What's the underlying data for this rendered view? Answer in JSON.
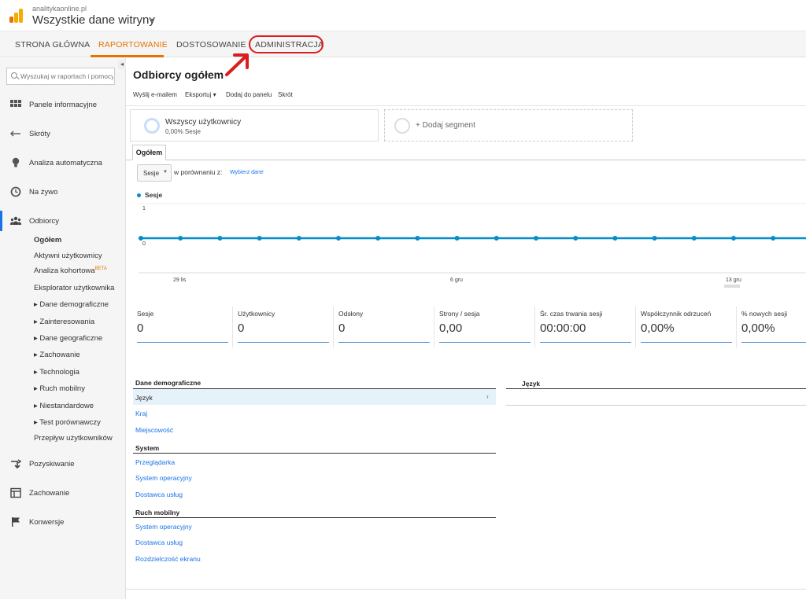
{
  "header": {
    "account": "analitykaonline.pl",
    "property": "Wszystkie dane witryny"
  },
  "nav": {
    "home": "STRONA GŁÓWNA",
    "reporting": "RAPORTOWANIE",
    "customization": "DOSTOSOWANIE",
    "admin": "ADMINISTRACJA",
    "active_color": "#e37400",
    "highlight_color": "#d81e1e"
  },
  "sidebar": {
    "search_placeholder": "Wyszukaj w raportach i pomocy",
    "items": [
      {
        "label": "Panele informacyjne",
        "icon": "grid-icon"
      },
      {
        "label": "Skróty",
        "icon": "shortcut-arrows-icon"
      },
      {
        "label": "Analiza automatyczna",
        "icon": "lightbulb-icon"
      },
      {
        "label": "Na żywo",
        "icon": "clock-icon"
      },
      {
        "label": "Odbiorcy",
        "icon": "people-icon"
      },
      {
        "label": "Pozyskiwanie",
        "icon": "acquisition-arrows-icon"
      },
      {
        "label": "Zachowanie",
        "icon": "layout-icon"
      },
      {
        "label": "Konwersje",
        "icon": "flag-icon"
      }
    ],
    "audience_sub": [
      "Ogółem",
      "Aktywni użytkownicy",
      "Analiza kohortowa",
      "Eksplorator użytkownika",
      "▸ Dane demograficzne",
      "▸ Zainteresowania",
      "▸ Dane geograficzne",
      "▸ Zachowanie",
      "▸ Technologia",
      "▸ Ruch mobilny",
      "▸ Niestandardowe",
      "▸ Test porównawczy",
      "Przepływ użytkowników"
    ],
    "beta": "BETA"
  },
  "main": {
    "title": "Odbiorcy ogółem",
    "toolbar": [
      "Wyślij e-mailem",
      "Eksportuj",
      "Dodaj do panelu",
      "Skrót"
    ],
    "segment": {
      "name": "Wszyscy użytkownicy",
      "pct": "0,00% Sesje"
    },
    "add_segment": "+ Dodaj segment",
    "tab": "Ogółem",
    "metric_select": "Sesje",
    "compare_label": "w porównaniu z:",
    "compare_link": "Wybierz dane",
    "legend": "Sesje"
  },
  "chart_data": {
    "type": "line",
    "series": [
      {
        "name": "Sesje",
        "values": [
          0,
          0,
          0,
          0,
          0,
          0,
          0,
          0,
          0,
          0,
          0,
          0,
          0,
          0,
          0,
          0,
          0,
          0
        ]
      }
    ],
    "y_ticks": [
      "1",
      "0"
    ],
    "ylim": [
      0,
      1
    ],
    "x_tick_labels": [
      "29 lis",
      "6 gru",
      "13 gru"
    ],
    "color": "#058dc7"
  },
  "scorecards": [
    {
      "label": "Sesje",
      "value": "0"
    },
    {
      "label": "Użytkownicy",
      "value": "0"
    },
    {
      "label": "Odsłony",
      "value": "0"
    },
    {
      "label": "Strony / sesja",
      "value": "0,00"
    },
    {
      "label": "Śr. czas trwania sesji",
      "value": "00:00:00"
    },
    {
      "label": "Współczynnik odrzuceń",
      "value": "0,00%"
    },
    {
      "label": "% nowych sesji",
      "value": "0,00%"
    }
  ],
  "tables": {
    "demographics_head": "Dane demograficzne",
    "demographics": [
      "Język",
      "Kraj",
      "Miejscowość"
    ],
    "system_head": "System",
    "system": [
      "Przeglądarka",
      "System operacyjny",
      "Dostawca usług"
    ],
    "mobile_head": "Ruch mobilny",
    "mobile": [
      "System operacyjny",
      "Dostawca usług",
      "Rozdzielczość ekranu"
    ],
    "right_head": "Język"
  }
}
